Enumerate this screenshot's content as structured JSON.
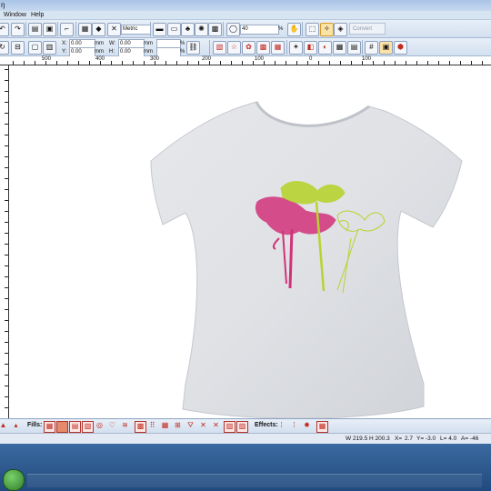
{
  "titlebar": {
    "fragment": "ŋ"
  },
  "menu": {
    "window": "Window",
    "help": "Help"
  },
  "toolbar1": {
    "units": "Metric",
    "zoom_value": "40",
    "zoom_unit": "%",
    "convert_label": "Convert"
  },
  "toolbar2": {
    "x_label": "X:",
    "x_value": "0.00",
    "x_unit": "mm",
    "y_label": "Y:",
    "y_value": "0.00",
    "y_unit": "mm",
    "w_label": "W:",
    "w_value": "0.00",
    "w_unit": "mm",
    "h_label": "H:",
    "h_value": "0.00",
    "h_unit": "mm",
    "pct1": "%",
    "pct2": "%"
  },
  "ruler": {
    "h_labels": [
      "500",
      "400",
      "300",
      "200",
      "100",
      "0",
      "100"
    ]
  },
  "bottombar": {
    "fills_label": "Fills:",
    "effects_label": "Effects:"
  },
  "statusbar": {
    "size": "W 219.5  H 200.3",
    "x": "X=",
    "zoom": "2.7",
    "y_val": "Y= -3.0",
    "l_val": "L= 4.0",
    "a_val": "A= -46"
  },
  "colors": {
    "accent": "#d7e4f2",
    "fill_icon": "#c2291f",
    "pink": "#d2327a",
    "lime": "#b7d331"
  }
}
